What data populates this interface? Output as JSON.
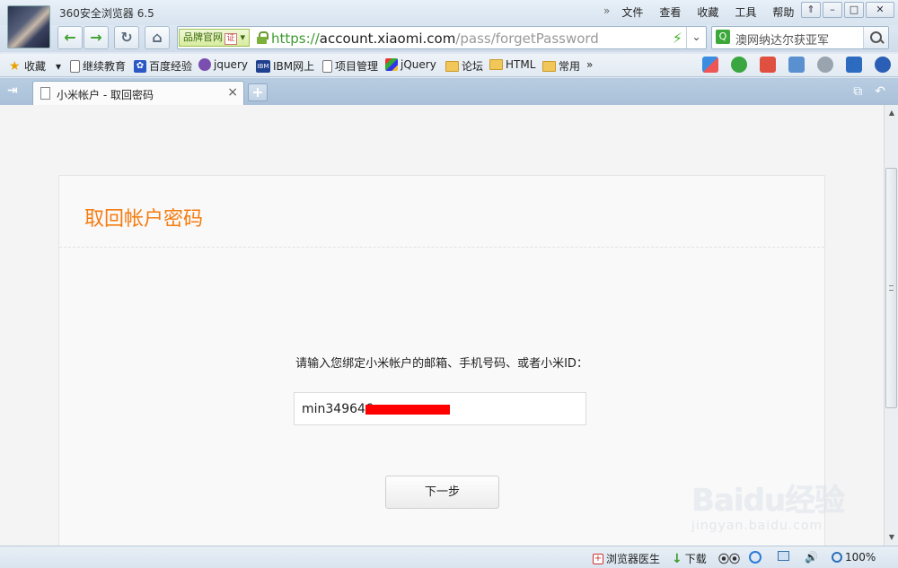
{
  "window": {
    "app_title": "360安全浏览器 6.5",
    "menu": [
      "文件",
      "查看",
      "收藏",
      "工具",
      "帮助"
    ],
    "menu_more": "»",
    "controls": [
      "⇑",
      "–",
      "□",
      "✕"
    ]
  },
  "navbar": {
    "brand_tag": "品牌官网",
    "cert_label": "证",
    "url_scheme": "https://",
    "url_domain": "account.xiaomi.com",
    "url_path": "/pass/forgetPassword",
    "search_text": "澳网纳达尔获亚军"
  },
  "bookmarks": {
    "items": [
      {
        "label": "收藏",
        "icon": "star-icon"
      },
      {
        "label": "继续教育",
        "icon": "page-icon"
      },
      {
        "label": "百度经验",
        "icon": "baidu-paw-icon"
      },
      {
        "label": "jquery",
        "icon": "php-icon"
      },
      {
        "label": "IBM网上",
        "icon": "ibm-icon"
      },
      {
        "label": "项目管理",
        "icon": "page-icon"
      },
      {
        "label": "jQuery",
        "icon": "jquery-icon"
      },
      {
        "label": "论坛",
        "icon": "folder-icon"
      },
      {
        "label": "HTML",
        "icon": "folder-icon"
      },
      {
        "label": "常用",
        "icon": "folder-icon"
      }
    ],
    "more": "»"
  },
  "tabs": {
    "active_title": "小米帐户 - 取回密码",
    "close": "×",
    "new_tab": "+"
  },
  "page": {
    "title": "取回帐户密码",
    "prompt": "请输入您绑定小米帐户的邮箱、手机号码、或者小米ID：",
    "input_value": "min349646",
    "next_button": "下一步"
  },
  "statusbar": {
    "doctor": "浏览器医生",
    "download": "下载",
    "zoom": "100%"
  },
  "watermark": {
    "text": "Baidu经验",
    "sub": "jingyan.baidu.com"
  },
  "colors": {
    "accent_orange": "#f57c10",
    "url_green": "#3c9a2e",
    "redaction": "#ff0000"
  }
}
